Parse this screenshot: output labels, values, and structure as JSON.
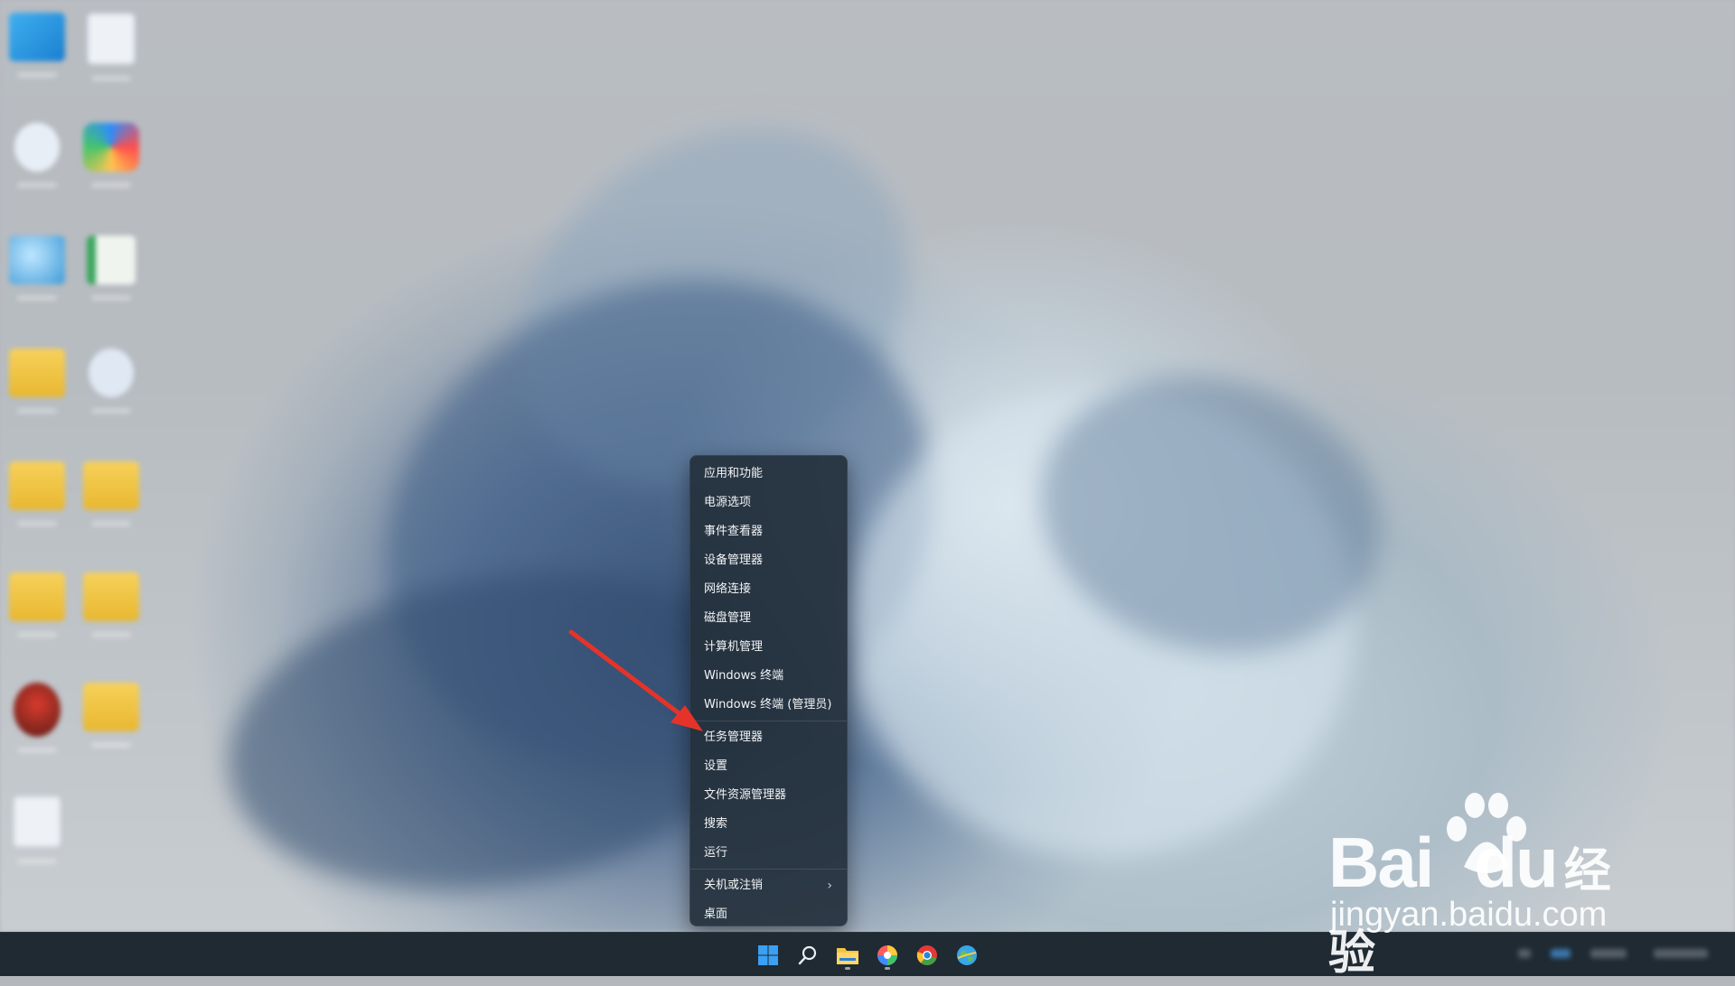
{
  "context_menu": {
    "items": [
      "应用和功能",
      "电源选项",
      "事件查看器",
      "设备管理器",
      "网络连接",
      "磁盘管理",
      "计算机管理",
      "Windows 终端",
      "Windows 终端 (管理员)"
    ],
    "items_group2": [
      "任务管理器",
      "设置",
      "文件资源管理器",
      "搜索",
      "运行"
    ],
    "shutdown_label": "关机或注销",
    "desktop_label": "桌面",
    "highlighted_item": "任务管理器"
  },
  "taskbar": {
    "icons": [
      "windows-start-icon",
      "search-icon",
      "file-explorer-icon",
      "colorful-app-icon",
      "chrome-icon",
      "browser-globe-icon"
    ]
  },
  "desktop": {
    "icons": [
      "monitor-icon",
      "document-icon",
      "recycle-icon",
      "color-app-icon",
      "globe-app-icon",
      "spreadsheet-icon",
      "folder-icon",
      "cloud-icon",
      "folder-icon",
      "folder-icon",
      "folder-icon",
      "folder-icon",
      "avatar-icon",
      "folder-icon",
      "document-icon"
    ]
  },
  "watermark": {
    "brand": "Bai",
    "brand2": "du",
    "suffix": "经验",
    "url": "jingyan.baidu.com"
  },
  "colors": {
    "menu_bg": "#24303c",
    "taskbar_bg": "#1f2a33",
    "arrow": "#e6332a"
  }
}
